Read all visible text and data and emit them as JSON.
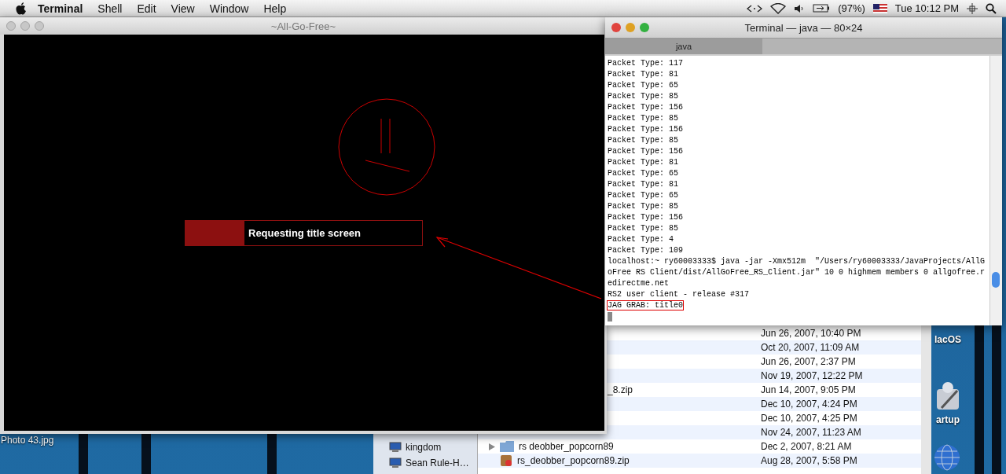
{
  "menu_bar": {
    "app": "Terminal",
    "menus": [
      "Shell",
      "Edit",
      "View",
      "Window",
      "Help"
    ],
    "battery": "(97%)",
    "clock": "Tue 10:12 PM"
  },
  "game_window": {
    "title": "~All-Go-Free~",
    "loading": {
      "label": "Requesting title screen",
      "level": 0.25
    }
  },
  "terminal_window": {
    "title": "Terminal — java — 80×24",
    "tabs": [
      {
        "label": "java",
        "selected": true
      }
    ],
    "lines": [
      {
        "text": "Packet Type: 117",
        "highlighted": false
      },
      {
        "text": "Packet Type: 81",
        "highlighted": false
      },
      {
        "text": "Packet Type: 65",
        "highlighted": false
      },
      {
        "text": "Packet Type: 85",
        "highlighted": false
      },
      {
        "text": "Packet Type: 156",
        "highlighted": false
      },
      {
        "text": "Packet Type: 85",
        "highlighted": false
      },
      {
        "text": "Packet Type: 156",
        "highlighted": false
      },
      {
        "text": "Packet Type: 85",
        "highlighted": false
      },
      {
        "text": "Packet Type: 156",
        "highlighted": false
      },
      {
        "text": "Packet Type: 81",
        "highlighted": false
      },
      {
        "text": "Packet Type: 65",
        "highlighted": false
      },
      {
        "text": "Packet Type: 81",
        "highlighted": false
      },
      {
        "text": "Packet Type: 65",
        "highlighted": false
      },
      {
        "text": "Packet Type: 85",
        "highlighted": false
      },
      {
        "text": "Packet Type: 156",
        "highlighted": false
      },
      {
        "text": "Packet Type: 85",
        "highlighted": false
      },
      {
        "text": "Packet Type: 4",
        "highlighted": false
      },
      {
        "text": "Packet Type: 109",
        "highlighted": false
      },
      {
        "text": "localhost:~ ry60003333$ java -jar -Xmx512m  \"/Users/ry60003333/JavaProjects/AllG",
        "highlighted": false
      },
      {
        "text": "oFree RS Client/dist/AllGoFree_RS_Client.jar\" 10 0 highmem members 0 allgofree.r",
        "highlighted": false
      },
      {
        "text": "edirectme.net",
        "highlighted": false
      },
      {
        "text": "RS2 user client - release #317",
        "highlighted": false
      },
      {
        "text": "JAG GRAB: title0",
        "highlighted": true
      }
    ]
  },
  "finder_window": {
    "sidebar": [
      "kingdom",
      "Sean Rule-H…"
    ],
    "files": [
      {
        "kind": "hidden",
        "date": "Jun 26, 2007, 10:40 PM"
      },
      {
        "kind": "hidden",
        "date": "Oct 20, 2007, 11:09 AM"
      },
      {
        "kind": "hidden",
        "date": "Jun 26, 2007, 2:37 PM"
      },
      {
        "kind": "hidden",
        "date": "Nov 19, 2007, 12:22 PM"
      },
      {
        "kind": "partial",
        "name": "_8.zip",
        "date": "Jun 14, 2007, 9:05 PM"
      },
      {
        "kind": "hidden",
        "date": "Dec 10, 2007, 4:24 PM"
      },
      {
        "kind": "hidden",
        "date": "Dec 10, 2007, 4:25 PM"
      },
      {
        "kind": "hidden",
        "date": "Nov 24, 2007, 11:23 AM"
      },
      {
        "kind": "folder",
        "name": "rs deobber_popcorn89",
        "date": "Dec 2, 2007, 8:21 AM"
      },
      {
        "kind": "zip",
        "name": "rs_deobber_popcorn89.zip",
        "date": "Aug 28, 2007, 5:58 PM"
      }
    ]
  },
  "desktop": {
    "file_label": "Photo 43.jpg",
    "icons": [
      "lacOS",
      "artup"
    ]
  }
}
